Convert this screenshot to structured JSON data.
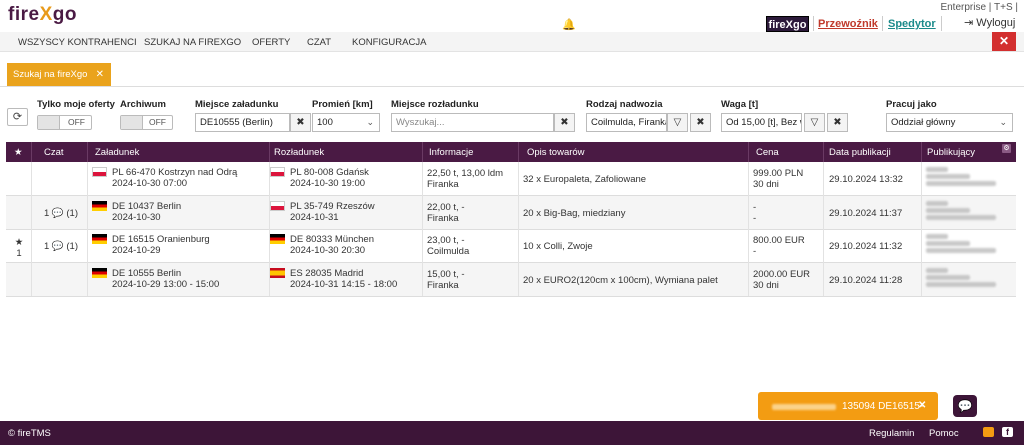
{
  "app": {
    "logo_part1": "fire",
    "logo_part2": "X",
    "logo_part3": "go",
    "enterprise": "Enterprise | T+S |",
    "brand_box": "fireXgo",
    "przewoznik": "Przewoźnik",
    "spedytor": "Spedytor",
    "logout": "Wyloguj"
  },
  "nav": [
    "WSZYSCY KONTRAHENCI",
    "SZUKAJ NA FIREXGO",
    "OFERTY",
    "CZAT",
    "KONFIGURACJA"
  ],
  "tab": {
    "label": "Szukaj na fireXgo"
  },
  "filters": {
    "own_offers_label": "Tylko moje oferty",
    "own_offers_value": "OFF",
    "archive_label": "Archiwum",
    "archive_value": "OFF",
    "loading_place_label": "Miejsce załadunku",
    "loading_place_value": "DE10555 (Berlin)",
    "radius_label": "Promień [km]",
    "radius_value": "100",
    "unloading_place_label": "Miejsce rozładunku",
    "unloading_place_placeholder": "Wyszukaj...",
    "body_type_label": "Rodzaj nadwozia",
    "body_type_value": "Coilmulda, Firanka",
    "weight_label": "Waga [t]",
    "weight_value": "Od 15,00 [t], Bez w",
    "work_as_label": "Pracuj jako",
    "work_as_value": "Oddział główny"
  },
  "table": {
    "headers": [
      "★",
      "Czat",
      "Załadunek",
      "Rozładunek",
      "Informacje",
      "Opis towarów",
      "Cena",
      "Data publikacji",
      "Publikujący"
    ],
    "rows": [
      {
        "star": "",
        "chat": "",
        "load_place": "PL 66-470 Kostrzyn nad Odrą",
        "load_date": "2024-10-30 07:00",
        "unload_place": "PL 80-008 Gdańsk",
        "unload_date": "2024-10-30 19:00",
        "info1": "22,50 t, 13,00 ldm",
        "info2": "Firanka",
        "desc": "32 x Europaleta, Zafoliowane",
        "price1": "999.00 PLN",
        "price2": "30 dni",
        "pub_date": "29.10.2024 13:32"
      },
      {
        "star": "",
        "chat": "1 💬 (1)",
        "load_place": "DE 10437 Berlin",
        "load_date": "2024-10-30",
        "unload_place": "PL 35-749 Rzeszów",
        "unload_date": "2024-10-31",
        "info1": "22,00 t, -",
        "info2": "Firanka",
        "desc": "20 x Big-Bag, miedziany",
        "price1": "-",
        "price2": "-",
        "pub_date": "29.10.2024 11:37"
      },
      {
        "star": "★ 1",
        "chat": "1 💬 (1)",
        "load_place": "DE 16515 Oranienburg",
        "load_date": "2024-10-29",
        "unload_place": "DE 80333 München",
        "unload_date": "2024-10-30 20:30",
        "info1": "23,00 t, -",
        "info2": "Coilmulda",
        "desc": "10 x Colli, Zwoje",
        "price1": "800.00 EUR",
        "price2": "-",
        "pub_date": "29.10.2024 11:32"
      },
      {
        "star": "",
        "chat": "",
        "load_place": "DE 10555 Berlin",
        "load_date": "2024-10-29 13:00 - 15:00",
        "unload_place": "ES 28035 Madrid",
        "unload_date": "2024-10-31 14:15 - 18:00",
        "info1": "15,00 t, -",
        "info2": "Firanka",
        "desc": "20 x EURO2(120cm x 100cm), Wymiana palet",
        "price1": "2000.00 EUR",
        "price2": "30 dni",
        "pub_date": "29.10.2024 11:28"
      }
    ]
  },
  "toast": {
    "text": "135094 DE16515-"
  },
  "footer": {
    "copyright": "© fireTMS",
    "regulamin": "Regulamin",
    "pomoc": "Pomoc"
  }
}
